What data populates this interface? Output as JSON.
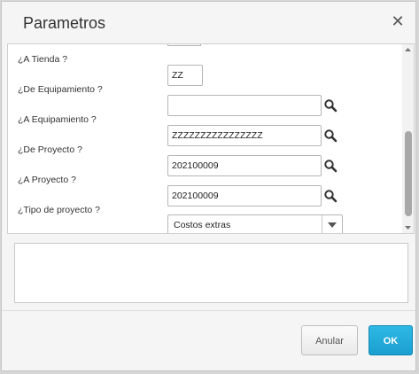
{
  "dialog": {
    "title": "Parametros",
    "close_icon": "close-icon"
  },
  "params": {
    "rows": [
      {
        "label": "¿A Tienda ?",
        "value": "ZZ",
        "search": false
      },
      {
        "label": "¿De Equipamiento ?",
        "value": "",
        "search": true
      },
      {
        "label": "¿A Equipamiento ?",
        "value": "ZZZZZZZZZZZZZZZZ",
        "search": true
      },
      {
        "label": "¿De Proyecto ?",
        "value": "202100009",
        "search": true
      },
      {
        "label": "¿A Proyecto ?",
        "value": "202100009",
        "search": true
      },
      {
        "label": "¿Tipo de proyecto ?",
        "value": "Costos extras",
        "search": false,
        "type": "select"
      }
    ]
  },
  "footer": {
    "cancel_label": "Anular",
    "ok_label": "OK"
  },
  "colors": {
    "accent": "#1fa8d8",
    "background": "#f5f5f5"
  }
}
